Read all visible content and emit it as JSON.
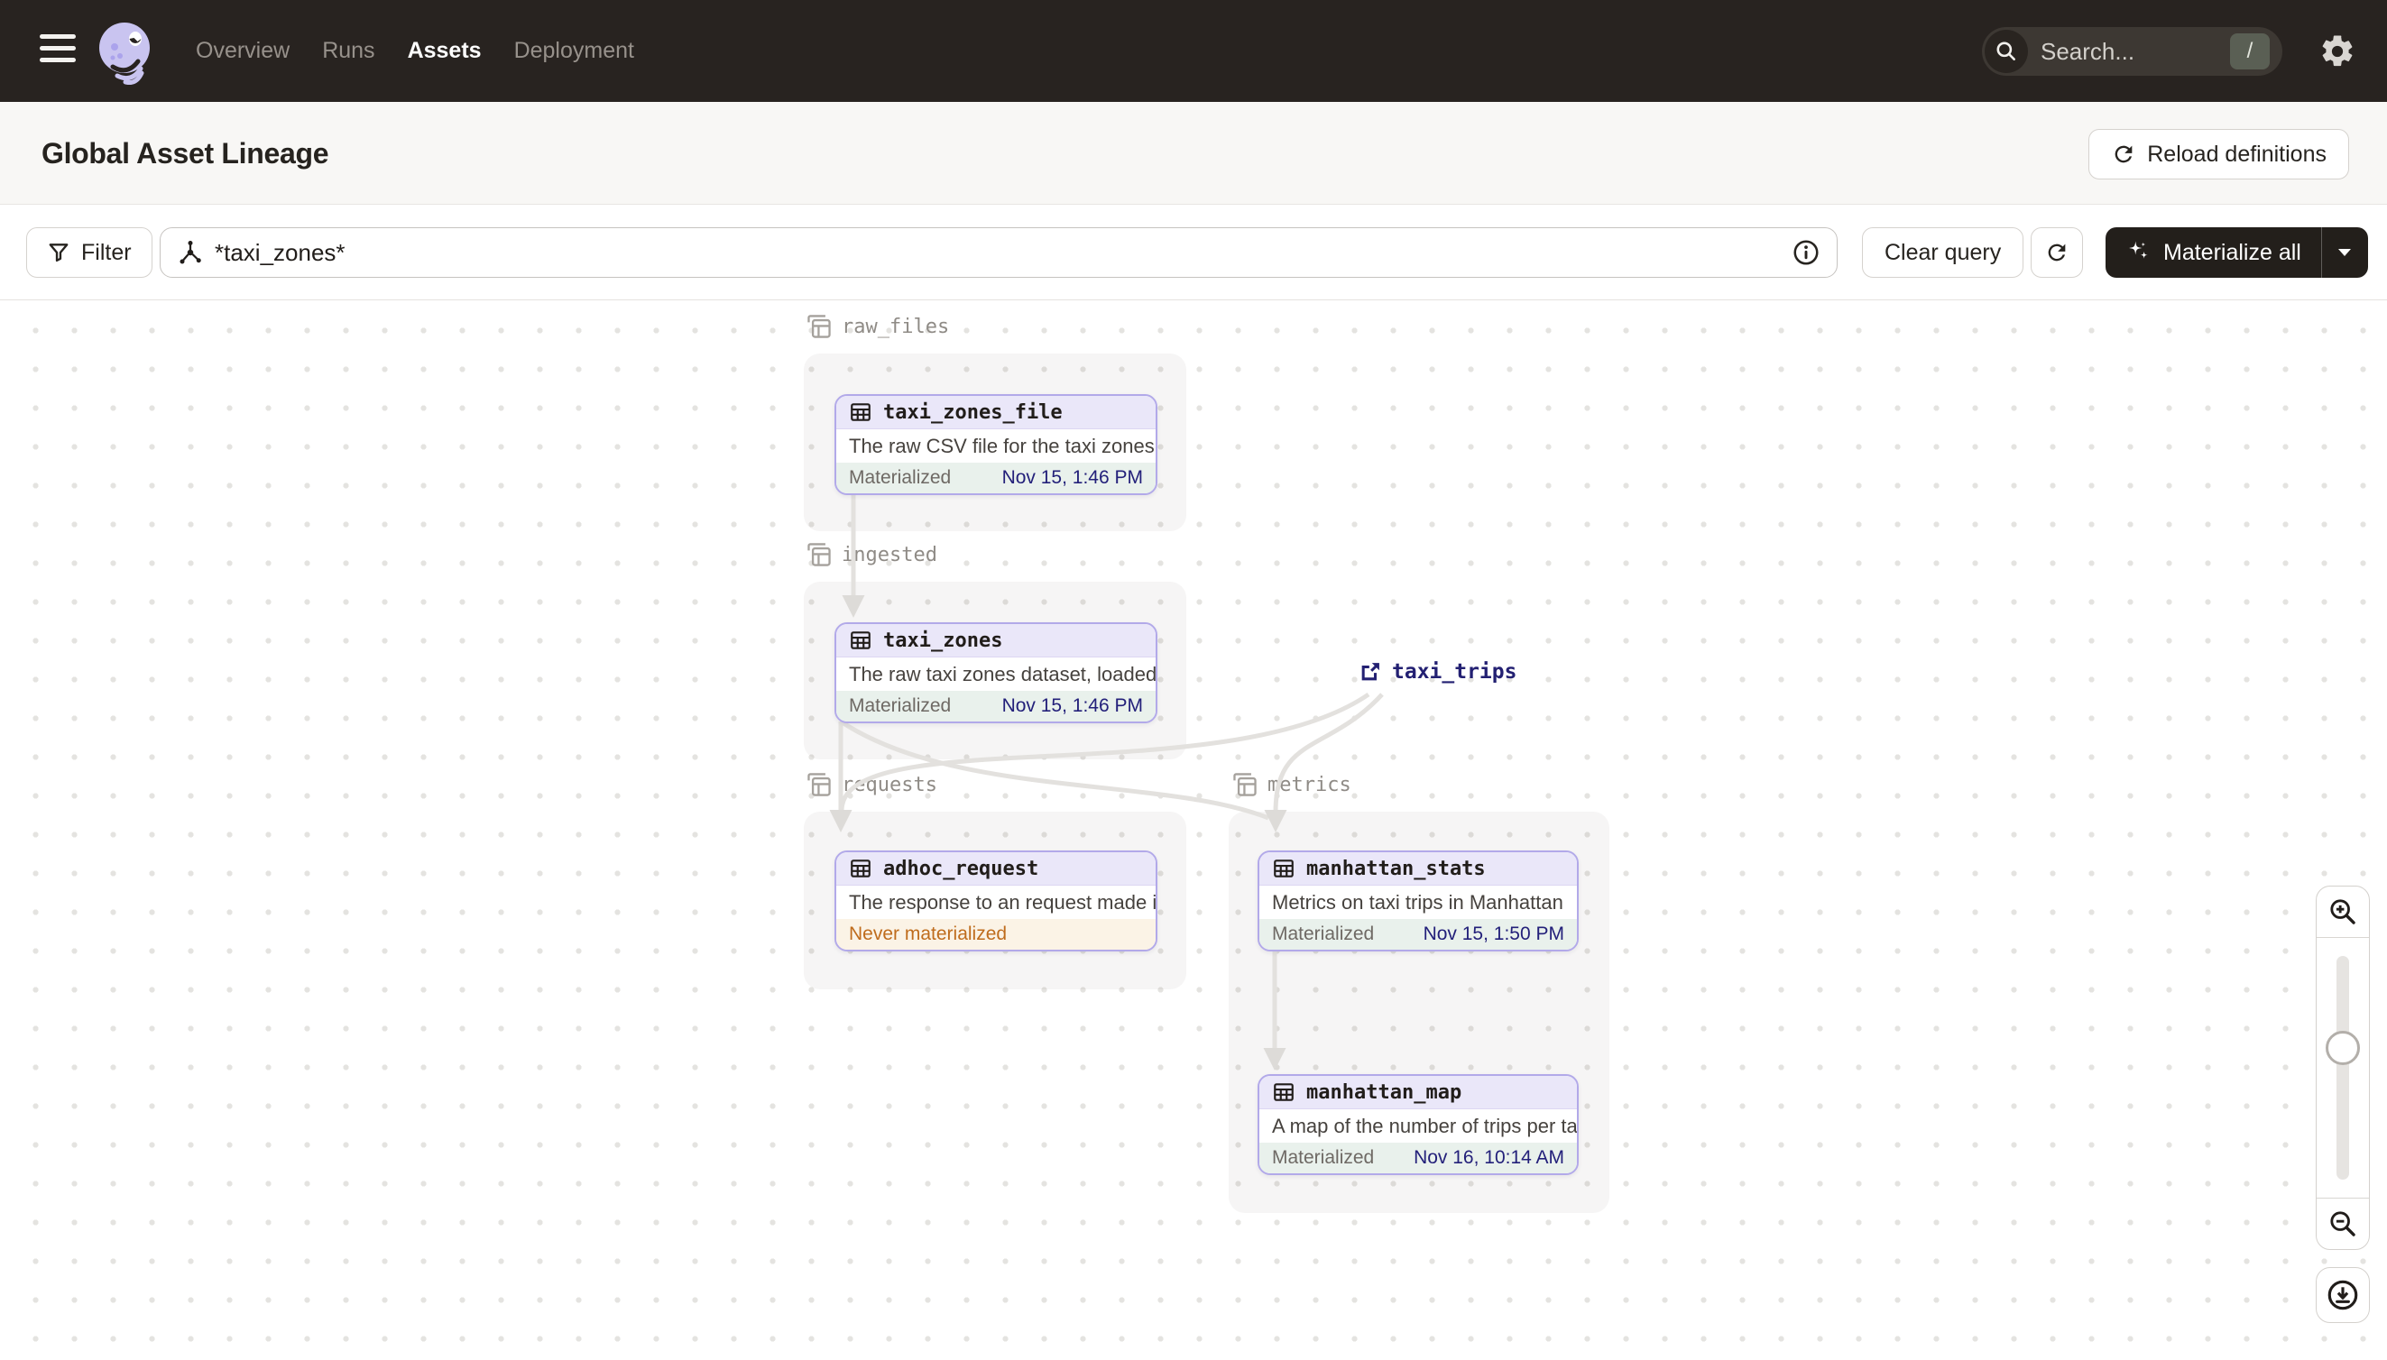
{
  "nav": {
    "items": [
      {
        "label": "Overview",
        "active": false
      },
      {
        "label": "Runs",
        "active": false
      },
      {
        "label": "Assets",
        "active": true
      },
      {
        "label": "Deployment",
        "active": false
      }
    ],
    "search": {
      "placeholder": "Search...",
      "shortcut": "/"
    }
  },
  "header": {
    "title": "Global Asset Lineage",
    "reload_button": "Reload definitions"
  },
  "toolbar": {
    "filter_button": "Filter",
    "query_value": "*taxi_zones*",
    "clear_button": "Clear query",
    "materialize_button": "Materialize all"
  },
  "graph": {
    "groups": [
      {
        "name": "raw_files"
      },
      {
        "name": "ingested"
      },
      {
        "name": "requests"
      },
      {
        "name": "metrics"
      }
    ],
    "nodes": [
      {
        "title": "taxi_zones_file",
        "group": "raw_files",
        "description": "The raw CSV file for the taxi zones dat…",
        "status": "Materialized",
        "timestamp": "Nov 15, 1:46 PM"
      },
      {
        "title": "taxi_zones",
        "group": "ingested",
        "description": "The raw taxi zones dataset, loaded int…",
        "status": "Materialized",
        "timestamp": "Nov 15, 1:46 PM"
      },
      {
        "title": "adhoc_request",
        "group": "requests",
        "description": "The response to an request made in th…",
        "status": "Never materialized",
        "timestamp": ""
      },
      {
        "title": "manhattan_stats",
        "group": "metrics",
        "description": "Metrics on taxi trips in Manhattan",
        "status": "Materialized",
        "timestamp": "Nov 15, 1:50 PM"
      },
      {
        "title": "manhattan_map",
        "group": "metrics",
        "description": "A map of the number of trips per taxi z…",
        "status": "Materialized",
        "timestamp": "Nov 16, 10:14 AM"
      }
    ],
    "external_assets": [
      {
        "title": "taxi_trips"
      }
    ],
    "edges": [
      {
        "from": "taxi_zones_file",
        "to": "taxi_zones"
      },
      {
        "from": "taxi_zones",
        "to": "adhoc_request"
      },
      {
        "from": "taxi_zones",
        "to": "manhattan_stats"
      },
      {
        "from": "taxi_trips",
        "to": "adhoc_request"
      },
      {
        "from": "taxi_trips",
        "to": "manhattan_stats"
      },
      {
        "from": "manhattan_stats",
        "to": "manhattan_map"
      }
    ]
  },
  "colors": {
    "nav_bg": "#282320",
    "accent_lavender": "#b2a9e9",
    "node_header_bg": "#eae7f9",
    "materialized_bg": "#e9f1ec",
    "never_materialized_bg": "#fbf3e6",
    "never_materialized_text": "#bf6c1d",
    "timestamp_text": "#23207a",
    "edge": "#e3e1de"
  }
}
